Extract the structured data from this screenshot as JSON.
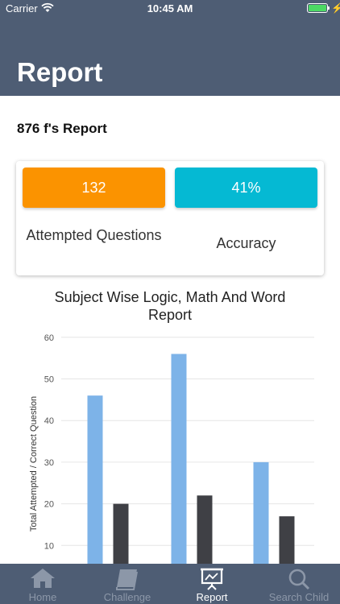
{
  "status_bar": {
    "carrier": "Carrier",
    "time": "10:45 AM",
    "battery_level": 1.0
  },
  "header": {
    "title": "Report"
  },
  "report": {
    "heading": "876 f's Report"
  },
  "stats": {
    "attempted_value": "132",
    "attempted_label": "Attempted Questions",
    "accuracy_value": "41%",
    "accuracy_label": "Accuracy",
    "colors": {
      "attempted": "#fb9300",
      "accuracy": "#05b9d3"
    }
  },
  "chart_data": {
    "type": "bar",
    "title": "Subject Wise Logic, Math And Word Report",
    "ylabel": "Total Attempted / Correct Question",
    "xlabel": "",
    "yticks": [
      10,
      20,
      30,
      40,
      50,
      60
    ],
    "ylim": [
      0,
      60
    ],
    "grid": true,
    "categories": [
      "",
      "",
      ""
    ],
    "series": [
      {
        "values": [
          46,
          56,
          30
        ],
        "color": "#7db3e8"
      },
      {
        "values": [
          20,
          22,
          17
        ],
        "color": "#3f4045"
      }
    ]
  },
  "tabbar": {
    "items": [
      {
        "label": "Home",
        "icon": "home-icon",
        "active": false
      },
      {
        "label": "Challenge",
        "icon": "book-icon",
        "active": false
      },
      {
        "label": "Report",
        "icon": "report-chart-icon",
        "active": true
      },
      {
        "label": "Search Child",
        "icon": "search-icon",
        "active": false
      }
    ]
  }
}
